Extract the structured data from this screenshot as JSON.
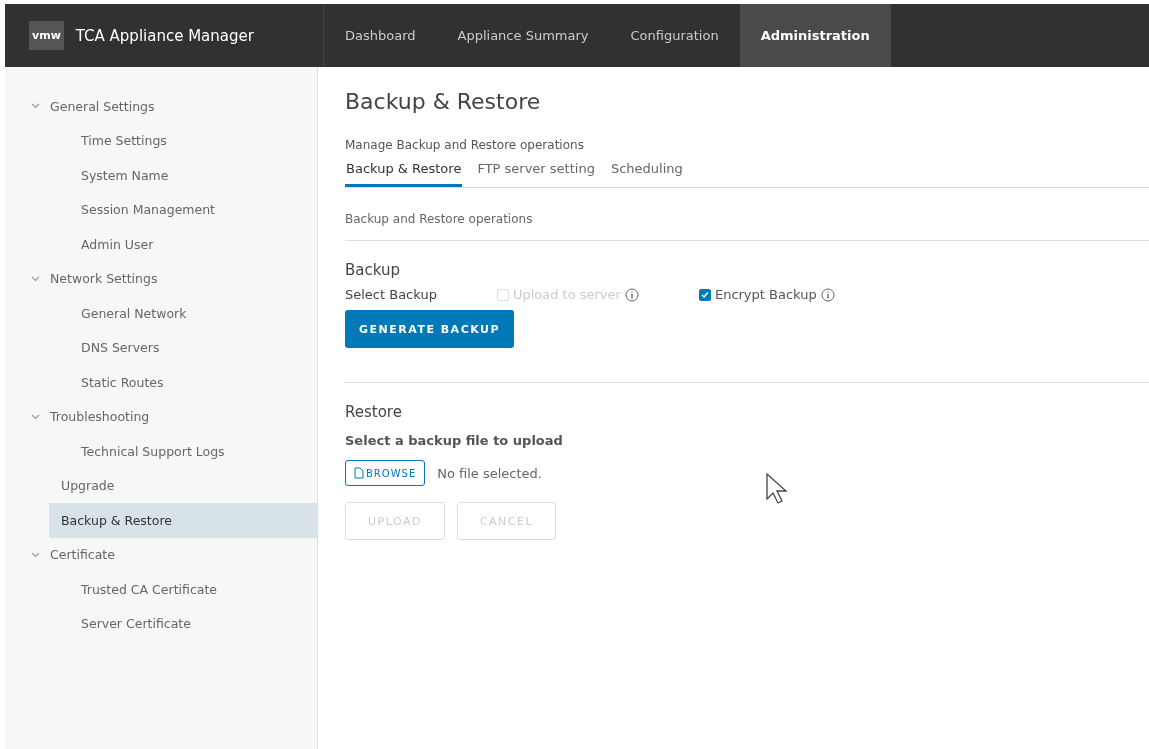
{
  "header": {
    "logo": "vmw",
    "title": "TCA Appliance Manager",
    "nav": [
      {
        "label": "Dashboard",
        "selected": false
      },
      {
        "label": "Appliance Summary",
        "selected": false
      },
      {
        "label": "Configuration",
        "selected": false
      },
      {
        "label": "Administration",
        "selected": true
      }
    ]
  },
  "sidebar": {
    "items": [
      {
        "label": "General Settings",
        "expanded": true,
        "selected": false,
        "children": [
          {
            "label": "Time Settings",
            "selected": false
          },
          {
            "label": "System Name",
            "selected": false
          },
          {
            "label": "Session Management",
            "selected": false
          },
          {
            "label": "Admin User",
            "selected": false
          }
        ]
      },
      {
        "label": "Network Settings",
        "expanded": true,
        "selected": false,
        "children": [
          {
            "label": "General Network",
            "selected": false
          },
          {
            "label": "DNS Servers",
            "selected": false
          },
          {
            "label": "Static Routes",
            "selected": false
          }
        ]
      },
      {
        "label": "Troubleshooting",
        "expanded": true,
        "selected": false,
        "children": [
          {
            "label": "Technical Support Logs",
            "selected": false
          }
        ]
      },
      {
        "label": "Upgrade",
        "selected": false
      },
      {
        "label": "Backup & Restore",
        "selected": true
      },
      {
        "label": "Certificate",
        "expanded": true,
        "selected": false,
        "children": [
          {
            "label": "Trusted CA Certificate",
            "selected": false
          },
          {
            "label": "Server Certificate",
            "selected": false
          }
        ]
      }
    ]
  },
  "page": {
    "title": "Backup & Restore",
    "subtitle": "Manage Backup and Restore operations",
    "tabs": [
      {
        "label": "Backup & Restore",
        "selected": true
      },
      {
        "label": "FTP server setting",
        "selected": false
      },
      {
        "label": "Scheduling",
        "selected": false
      }
    ],
    "section_label": "Backup and Restore operations",
    "backup": {
      "heading": "Backup",
      "select_label": "Select Backup",
      "options": [
        {
          "label": "Upload to server",
          "checked": false,
          "disabled": true
        },
        {
          "label": "Encrypt Backup",
          "checked": true,
          "disabled": false
        }
      ],
      "button": "GENERATE BACKUP"
    },
    "restore": {
      "heading": "Restore",
      "file_label": "Select a backup file to upload",
      "browse": "BROWSE",
      "file_status": "No file selected.",
      "buttons": [
        {
          "label": "UPLOAD",
          "disabled": true
        },
        {
          "label": "CANCEL",
          "disabled": true
        }
      ]
    }
  }
}
